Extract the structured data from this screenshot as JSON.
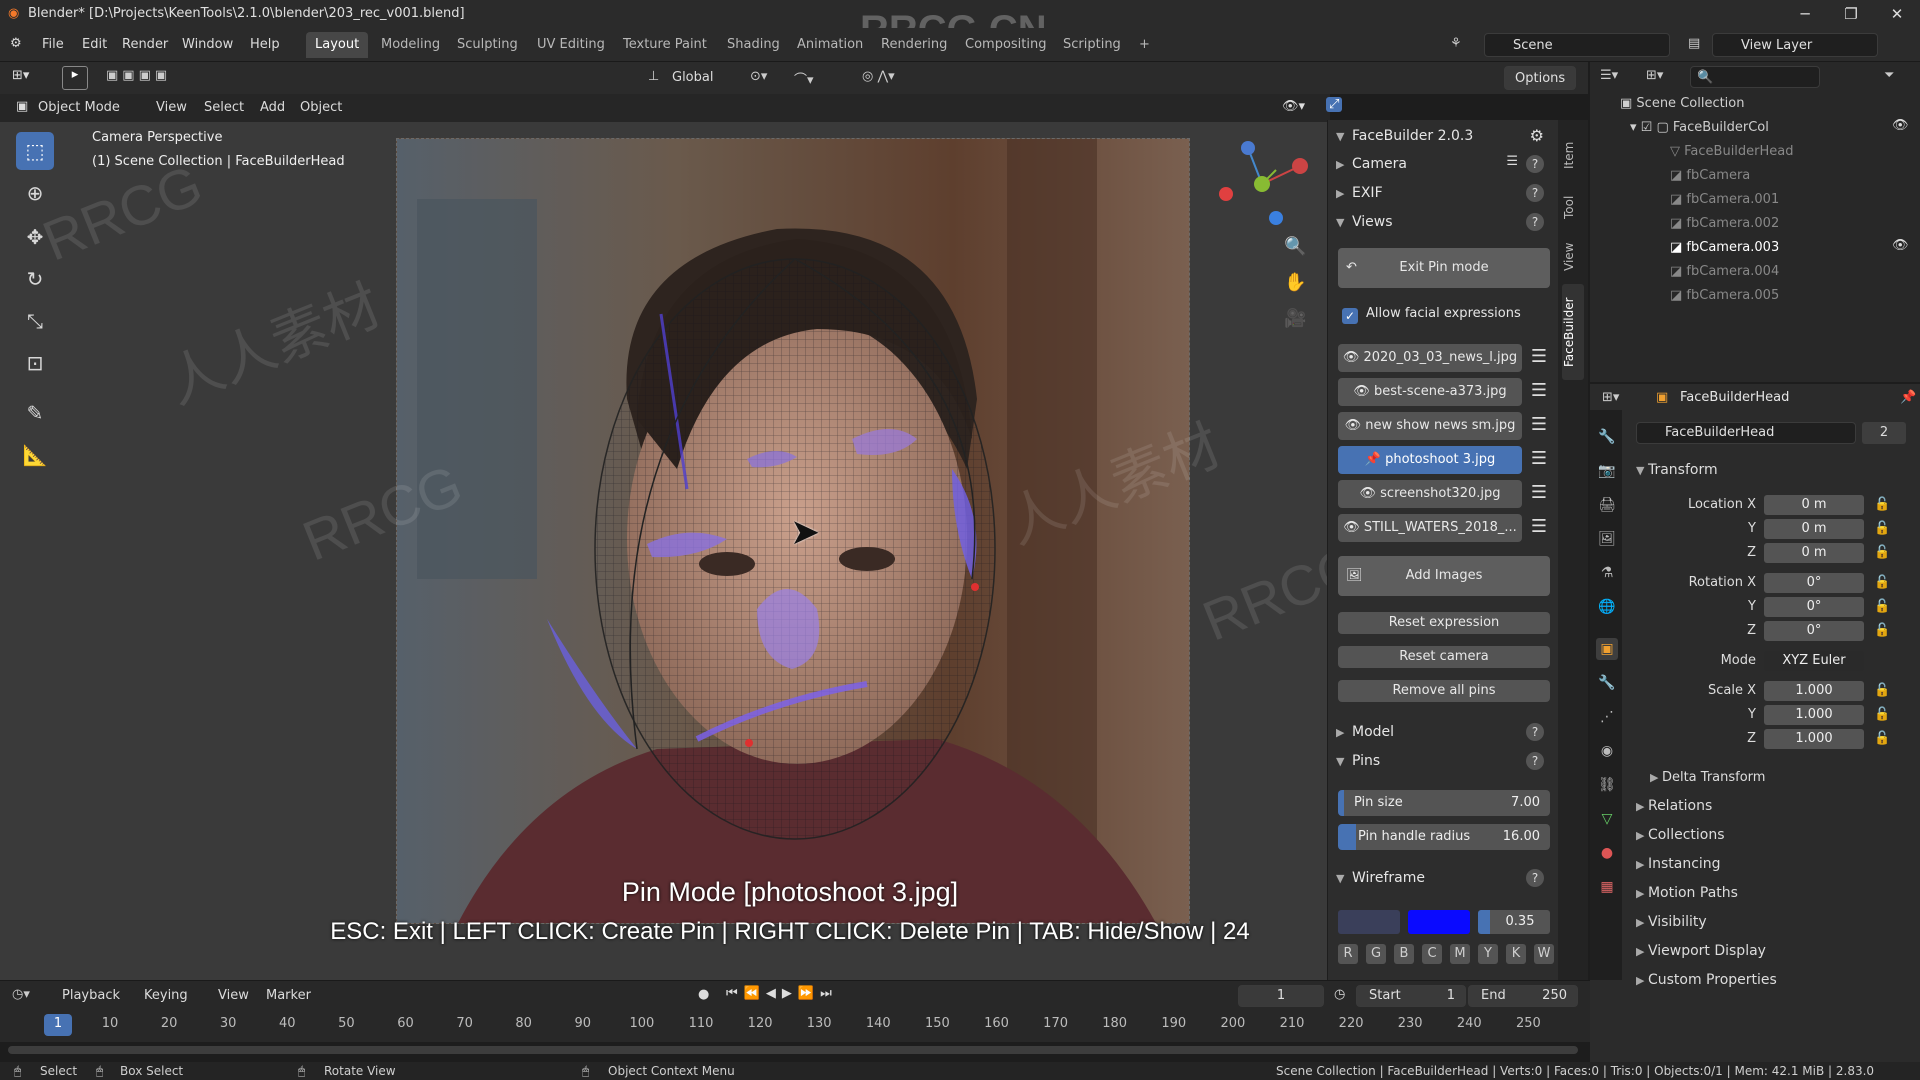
{
  "titlebar": {
    "text": "Blender* [D:\\Projects\\KeenTools\\2.1.0\\blender\\203_rec_v001.blend]",
    "watermark": "RRCG.CN"
  },
  "menus": [
    "File",
    "Edit",
    "Render",
    "Window",
    "Help"
  ],
  "workspaces": [
    "Layout",
    "Modeling",
    "Sculpting",
    "UV Editing",
    "Texture Paint",
    "Shading",
    "Animation",
    "Rendering",
    "Compositing",
    "Scripting",
    "+"
  ],
  "scene": {
    "label": "Scene",
    "view_layer": "View Layer"
  },
  "toolheader": {
    "orientation": "Global",
    "options": "Options"
  },
  "viewport_header": {
    "mode": "Object Mode",
    "view": "View",
    "select": "Select",
    "add": "Add",
    "object": "Object"
  },
  "viewport": {
    "perspective": "Camera Perspective",
    "collection": "(1) Scene Collection | FaceBuilderHead",
    "pin_mode": "Pin Mode  [photoshoot 3.jpg]",
    "pin_help": "ESC: Exit | LEFT CLICK: Create Pin | RIGHT CLICK: Delete Pin | TAB: Hide/Show | 24"
  },
  "npanel": {
    "title": "FaceBuilder 2.0.3",
    "camera": "Camera",
    "exif": "EXIF",
    "views": "Views",
    "exit_pin": "Exit Pin mode",
    "allow_expr": "Allow facial expressions",
    "images": [
      "2020_03_03_news_l.jpg",
      "best-scene-a373.jpg",
      "new show news sm.jpg",
      "photoshoot 3.jpg",
      "screenshot320.jpg",
      "STILL_WATERS_2018_..."
    ],
    "add_images": "Add Images",
    "reset_expression": "Reset expression",
    "reset_camera": "Reset camera",
    "remove_pins": "Remove all pins",
    "model": "Model",
    "pins": "Pins",
    "pin_size_label": "Pin size",
    "pin_size": "7.00",
    "pin_radius_label": "Pin handle radius",
    "pin_radius": "16.00",
    "wireframe": "Wireframe",
    "wire_opacity": "0.35",
    "wire_buttons": [
      "R",
      "G",
      "B",
      "C",
      "M",
      "Y",
      "K",
      "W"
    ]
  },
  "vtabs": [
    "Item",
    "Tool",
    "View",
    "FaceBuilder"
  ],
  "outliner": {
    "root": "Scene Collection",
    "collection": "FaceBuilderCol",
    "items": [
      "FaceBuilderHead",
      "fbCamera",
      "fbCamera.001",
      "fbCamera.002",
      "fbCamera.003",
      "fbCamera.004",
      "fbCamera.005"
    ]
  },
  "properties": {
    "object": "FaceBuilderHead",
    "users": "2",
    "transform": "Transform",
    "location_label": "Location X",
    "rotation_label": "Rotation X",
    "scale_label": "Scale X",
    "y": "Y",
    "z": "Z",
    "loc": [
      "0 m",
      "0 m",
      "0 m"
    ],
    "rot": [
      "0°",
      "0°",
      "0°"
    ],
    "mode_label": "Mode",
    "mode": "XYZ Euler",
    "scale": [
      "1.000",
      "1.000",
      "1.000"
    ],
    "sections": [
      "Delta Transform",
      "Relations",
      "Collections",
      "Instancing",
      "Motion Paths",
      "Visibility",
      "Viewport Display",
      "Custom Properties"
    ]
  },
  "timeline": {
    "playback": "Playback",
    "keying": "Keying",
    "view": "View",
    "marker": "Marker",
    "current": "1",
    "start_label": "Start",
    "start": "1",
    "end_label": "End",
    "end": "250",
    "ticks": [
      "1",
      "10",
      "20",
      "30",
      "40",
      "50",
      "60",
      "70",
      "80",
      "90",
      "100",
      "110",
      "120",
      "130",
      "140",
      "150",
      "160",
      "170",
      "180",
      "190",
      "200",
      "210",
      "220",
      "230",
      "240",
      "250"
    ]
  },
  "status": {
    "select": "Select",
    "box_select": "Box Select",
    "rotate": "Rotate View",
    "context": "Object Context Menu",
    "info": "Scene Collection | FaceBuilderHead | Verts:0 | Faces:0 | Tris:0 | Objects:0/1 | Mem: 42.1 MiB | 2.83.0"
  },
  "watermarks": [
    "RRCG",
    "人人素材",
    "RRCG",
    "人人素材",
    "RRCG"
  ]
}
